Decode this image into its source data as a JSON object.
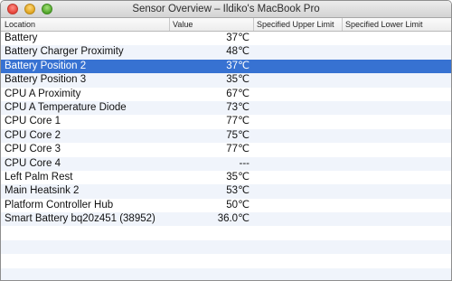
{
  "window": {
    "title": "Sensor Overview – Ildiko's MacBook Pro"
  },
  "table": {
    "columns": [
      "Location",
      "Value",
      "Specified Upper Limit",
      "Specified Lower Limit"
    ],
    "rows": [
      {
        "location": "Battery",
        "value": "37℃"
      },
      {
        "location": "Battery Charger Proximity",
        "value": "48℃"
      },
      {
        "location": "Battery Position 2",
        "value": "37℃",
        "selected": true
      },
      {
        "location": "Battery Position 3",
        "value": "35℃"
      },
      {
        "location": "CPU A Proximity",
        "value": "67℃"
      },
      {
        "location": "CPU A Temperature Diode",
        "value": "73℃"
      },
      {
        "location": "CPU Core 1",
        "value": "77℃"
      },
      {
        "location": "CPU Core 2",
        "value": "75℃"
      },
      {
        "location": "CPU Core 3",
        "value": "77℃"
      },
      {
        "location": "CPU Core 4",
        "value": "---"
      },
      {
        "location": "Left Palm Rest",
        "value": "35℃"
      },
      {
        "location": "Main Heatsink 2",
        "value": "53℃"
      },
      {
        "location": "Platform Controller Hub",
        "value": "50℃"
      },
      {
        "location": "Smart Battery bq20z451 (38952)",
        "value": "36.0℃"
      },
      {
        "location": "",
        "value": ""
      },
      {
        "location": "",
        "value": ""
      },
      {
        "location": "",
        "value": ""
      },
      {
        "location": "",
        "value": ""
      }
    ]
  }
}
